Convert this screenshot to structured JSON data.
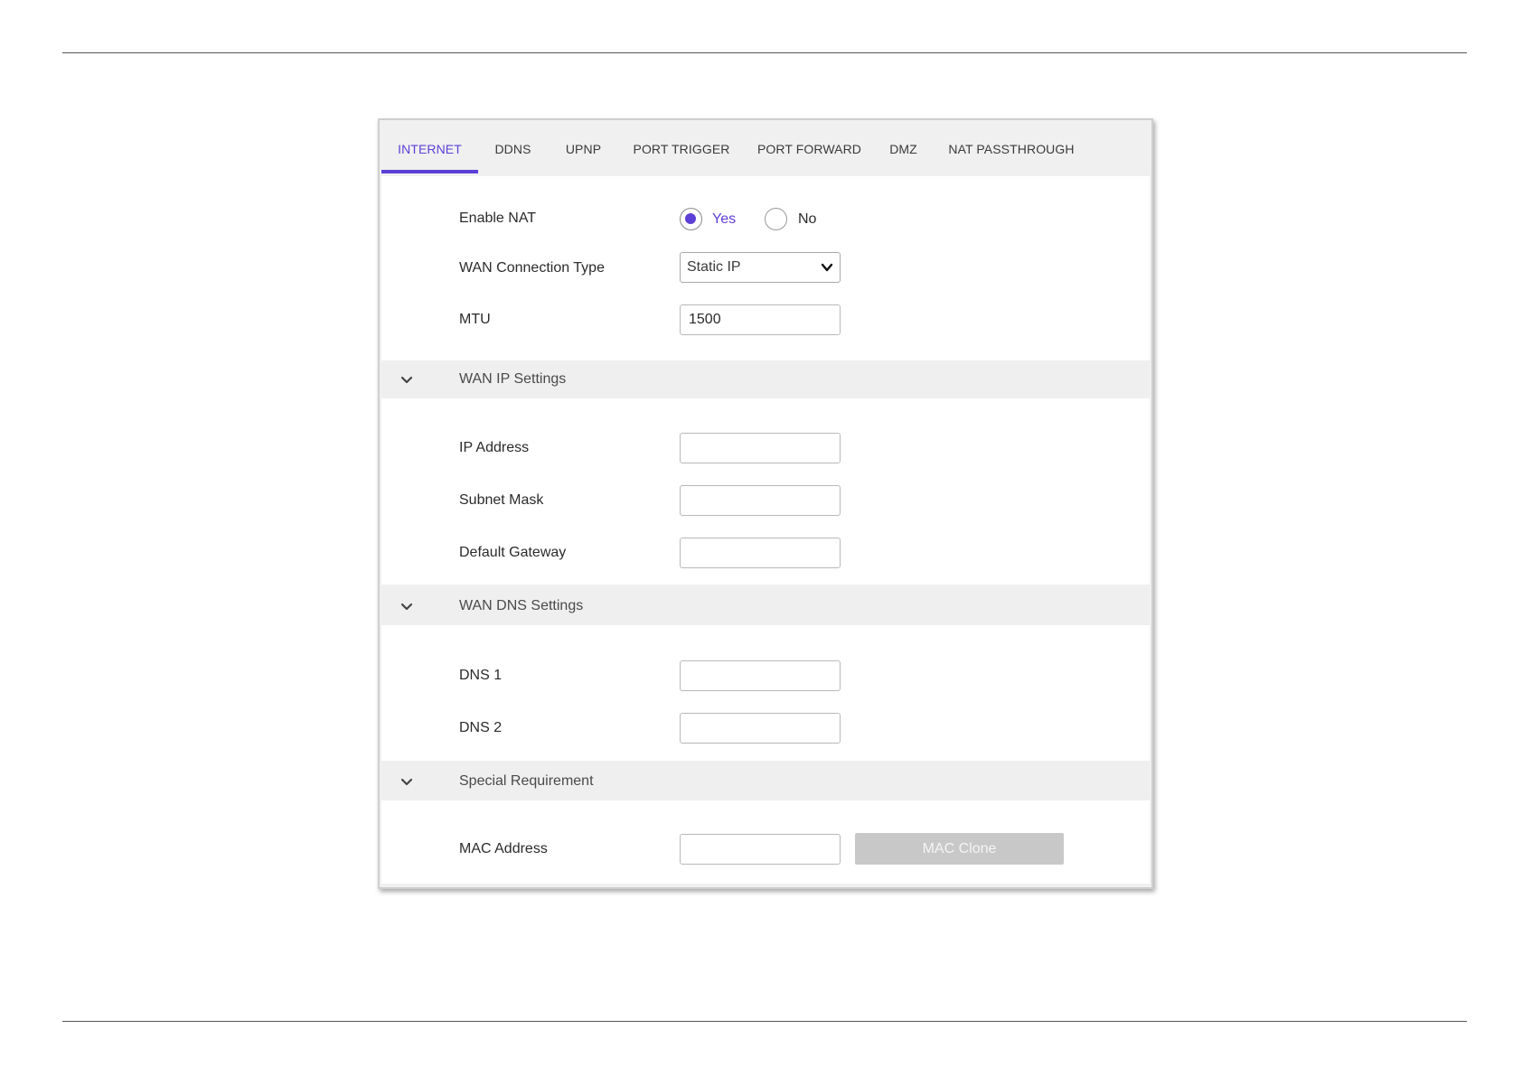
{
  "tabs": [
    {
      "label": "INTERNET",
      "active": true
    },
    {
      "label": "DDNS",
      "active": false
    },
    {
      "label": "UPNP",
      "active": false
    },
    {
      "label": "PORT TRIGGER",
      "active": false
    },
    {
      "label": "PORT FORWARD",
      "active": false
    },
    {
      "label": "DMZ",
      "active": false
    },
    {
      "label": "NAT PASSTHROUGH",
      "active": false
    }
  ],
  "general": {
    "enable_nat_label": "Enable NAT",
    "enable_nat_yes": "Yes",
    "enable_nat_no": "No",
    "enable_nat_selected": "Yes",
    "wan_type_label": "WAN Connection Type",
    "wan_type_value": "Static IP",
    "mtu_label": "MTU",
    "mtu_value": "1500"
  },
  "wan_ip": {
    "title": "WAN IP Settings",
    "ip_label": "IP Address",
    "ip_value": "",
    "subnet_label": "Subnet Mask",
    "subnet_value": "",
    "gateway_label": "Default Gateway",
    "gateway_value": ""
  },
  "wan_dns": {
    "title": "WAN DNS Settings",
    "dns1_label": "DNS 1",
    "dns1_value": "",
    "dns2_label": "DNS 2",
    "dns2_value": ""
  },
  "special": {
    "title": "Special Requirement",
    "mac_label": "MAC Address",
    "mac_value": "",
    "mac_clone_label": "MAC Clone"
  },
  "colors": {
    "accent": "#5c3fd6",
    "section_header_bg": "#efefef",
    "disabled_button": "#c8c8c8"
  }
}
